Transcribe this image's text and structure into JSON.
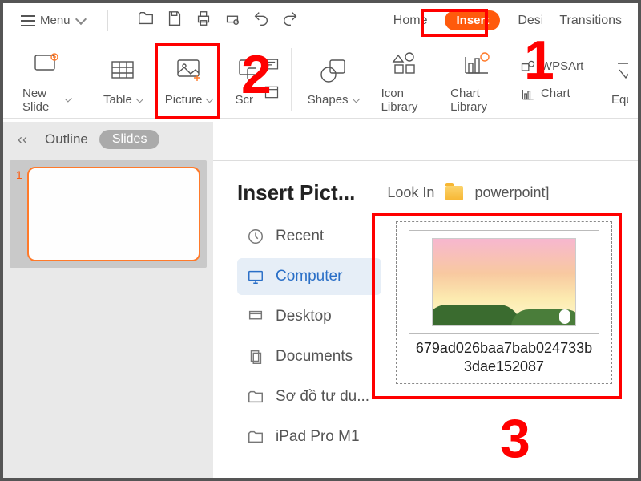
{
  "menu": {
    "label": "Menu"
  },
  "tabs": {
    "home": "Home",
    "insert": "Insert",
    "design": "Design",
    "transitions": "Transitions"
  },
  "ribbon": {
    "new_slide": "New Slide",
    "table": "Table",
    "picture": "Picture",
    "screenshot": "Screenshot",
    "shapes": "Shapes",
    "icon_library": "Icon Library",
    "chart_library": "Chart Library",
    "wpsart": "WPSArt",
    "chart": "Chart",
    "equation": "Equation"
  },
  "leftpanel": {
    "outline": "Outline",
    "slides": "Slides",
    "thumb_num": "1"
  },
  "dialog": {
    "title": "Insert Pict...",
    "look_in": "Look In",
    "folder": "powerpoint]",
    "sources": {
      "recent": "Recent",
      "computer": "Computer",
      "desktop": "Desktop",
      "documents": "Documents",
      "item5": "Sơ đồ tư du...",
      "item6": "iPad Pro M1"
    },
    "file": {
      "name_line1": "679ad026baa7bab024733b",
      "name_line2": "3dae152087"
    }
  },
  "annotations": {
    "n1": "1",
    "n2": "2",
    "n3": "3"
  }
}
